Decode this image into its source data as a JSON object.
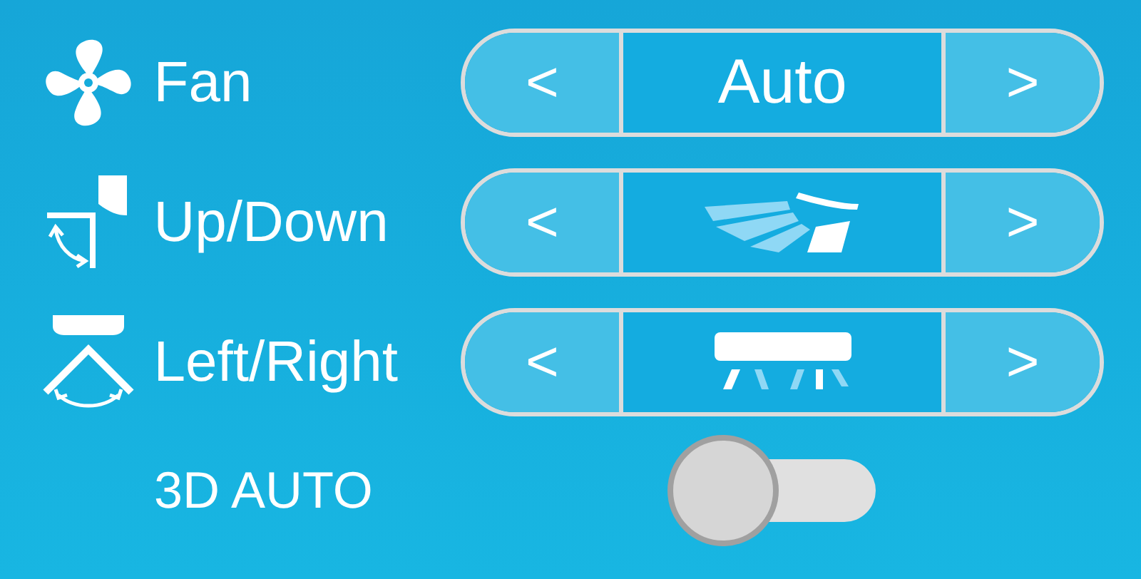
{
  "settings": [
    {
      "kind": "fan",
      "label": "Fan",
      "value": {
        "kind": "text",
        "text": "Auto"
      },
      "prev": "<",
      "next": ">"
    },
    {
      "kind": "vertical",
      "label": "Up/Down",
      "value": {
        "kind": "vertical"
      },
      "prev": "<",
      "next": ">"
    },
    {
      "kind": "horizontal",
      "label": "Left/Right",
      "value": {
        "kind": "horizontal"
      },
      "prev": "<",
      "next": ">"
    }
  ],
  "toggle": {
    "label": "3D AUTO",
    "on": false
  }
}
